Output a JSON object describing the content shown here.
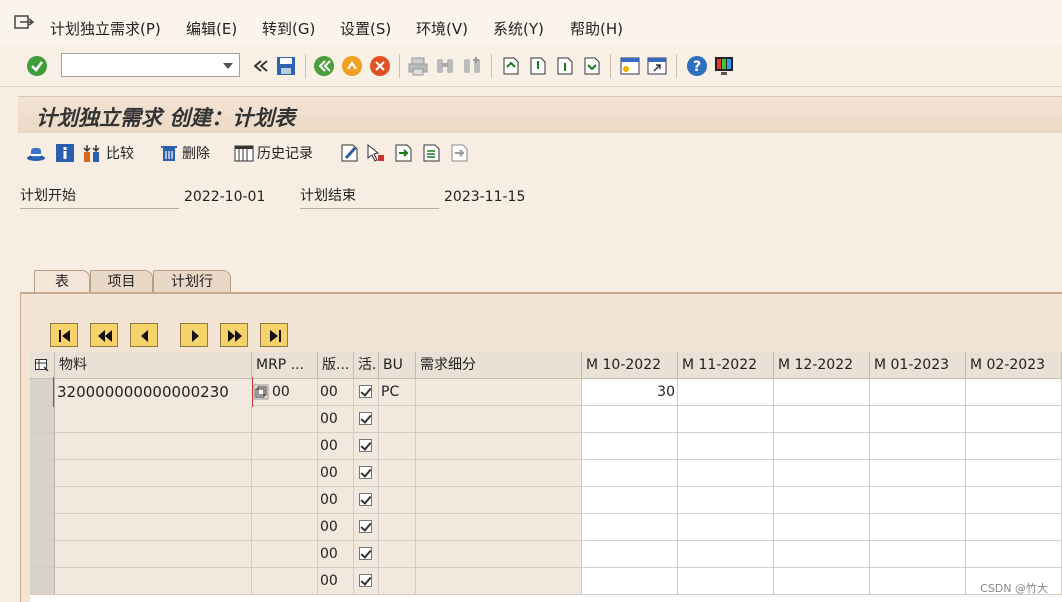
{
  "menu": {
    "items": [
      "计划独立需求(P)",
      "编辑(E)",
      "转到(G)",
      "设置(S)",
      "环境(V)",
      "系统(Y)",
      "帮助(H)"
    ]
  },
  "toolbar": {
    "command_value": ""
  },
  "title": "计划独立需求 创建：计划表",
  "app_toolbar": {
    "compare": "比较",
    "delete": "删除",
    "history": "历史记录"
  },
  "fields": {
    "plan_start_label": "计划开始",
    "plan_start_value": "2022-10-01",
    "plan_end_label": "计划结束",
    "plan_end_value": "2023-11-15"
  },
  "tabs": [
    "表",
    "项目",
    "计划行"
  ],
  "table": {
    "headers": [
      "物料",
      "MRP ...",
      "版...",
      "活.",
      "BU",
      "需求细分",
      "M 10-2022",
      "M 11-2022",
      "M 12-2022",
      "M 01-2023",
      "M 02-2023"
    ],
    "first_row": {
      "material": "320000000000000230",
      "mrp": "00",
      "version": "00",
      "unit": "PC",
      "m10_2022": "30"
    },
    "version_values": [
      "00",
      "00",
      "00",
      "00",
      "00",
      "00",
      "00",
      "00"
    ]
  },
  "watermark": "CSDN @竹大",
  "colors": {
    "accent": "#f6d36a",
    "background": "#f7ede3"
  }
}
